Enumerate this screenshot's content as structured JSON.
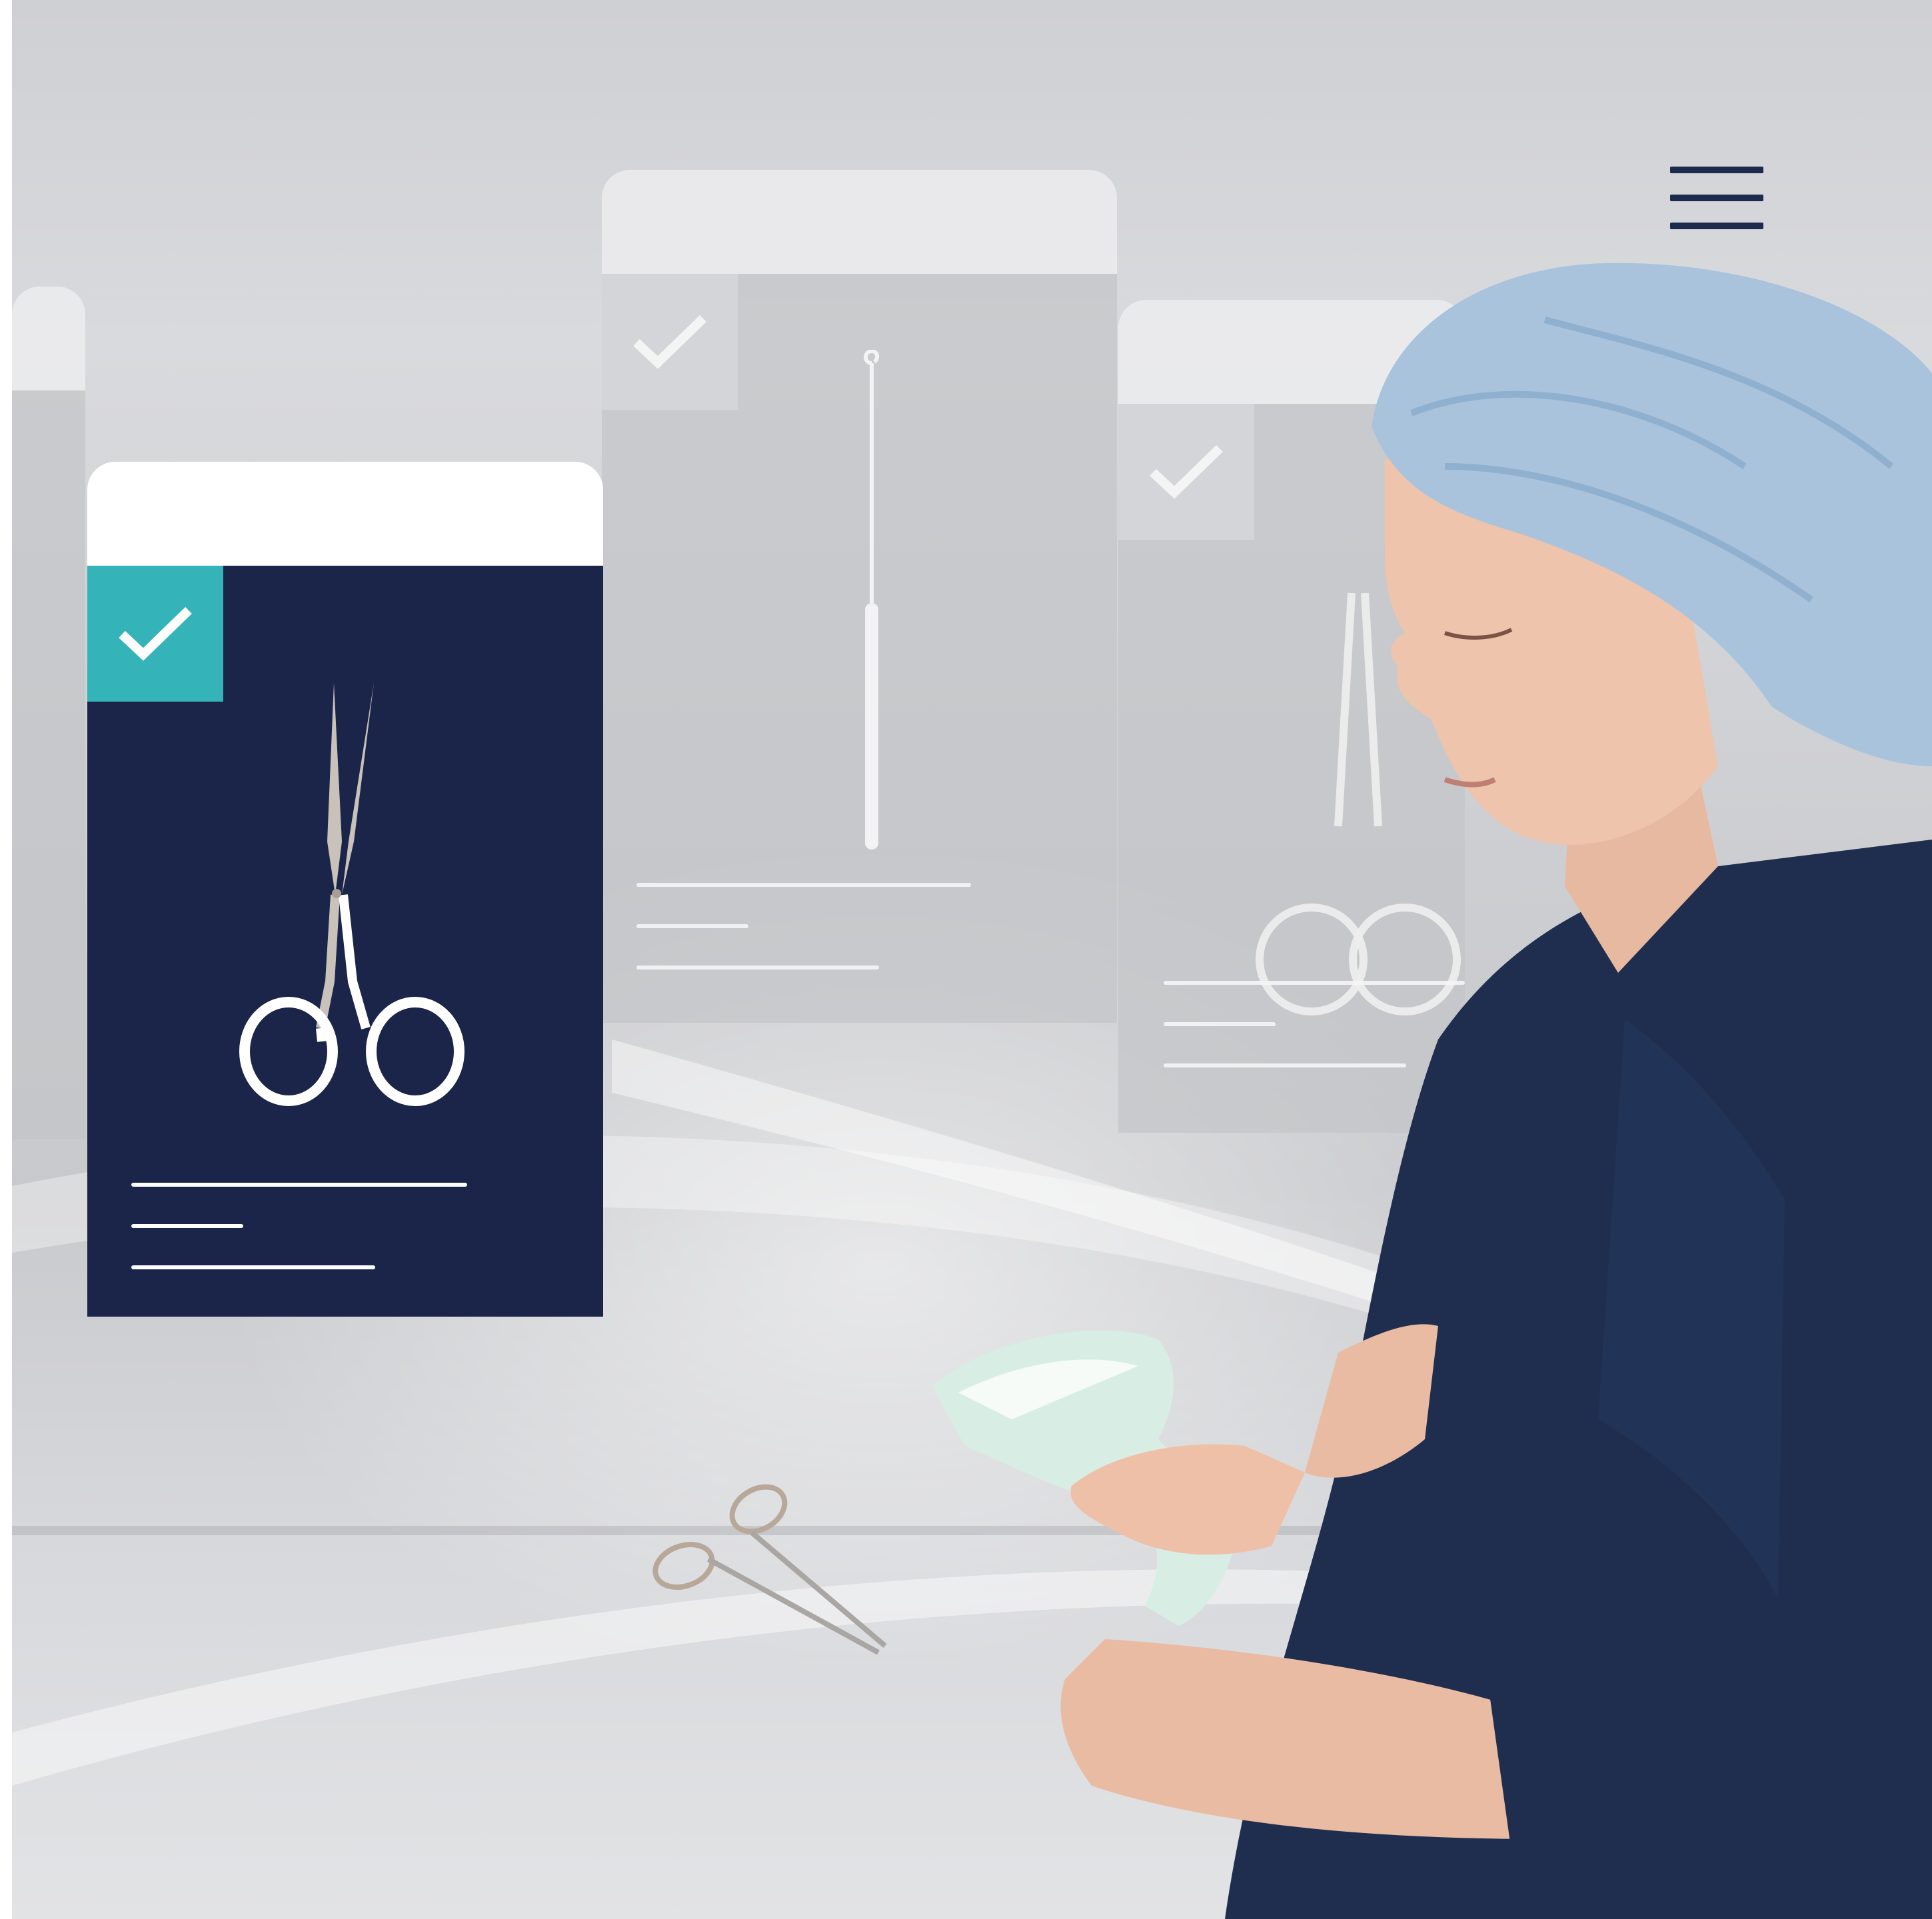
{
  "header": {
    "menu_icon": "hamburger-menu-icon"
  },
  "cards": [
    {
      "name": "instrument-card-scissors",
      "state": "active",
      "icon": "surgical-scissors-icon",
      "check_icon": "checkmark-icon"
    },
    {
      "name": "instrument-card-probe",
      "state": "inactive",
      "icon": "surgical-probe-icon",
      "check_icon": "checkmark-icon"
    },
    {
      "name": "instrument-card-scissors-faded",
      "state": "inactive",
      "icon": "surgical-scissors-icon",
      "check_icon": "checkmark-icon"
    }
  ],
  "colors": {
    "navy": "#1a2549",
    "teal": "#34b3b9",
    "scrub": "#1f2e4f",
    "cap": "#a9c3dc"
  },
  "photo": {
    "subject": "nurse-with-barcode-scanner",
    "objects": [
      "barcode-scanner-icon",
      "hemostat-forceps-icon"
    ]
  }
}
